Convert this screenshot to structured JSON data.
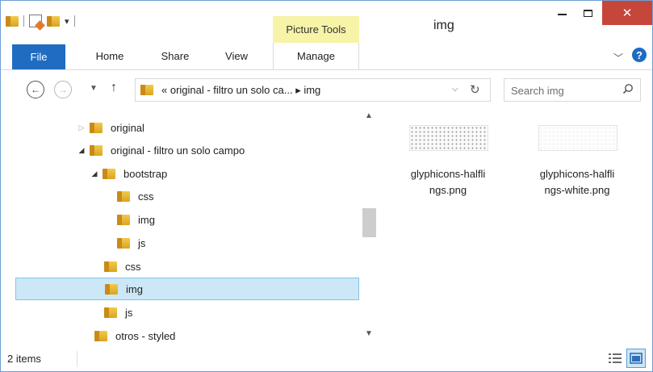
{
  "window": {
    "title": "img",
    "context_tab": "Picture Tools",
    "close_symbol": "✕"
  },
  "ribbon": {
    "tabs": [
      "File",
      "Home",
      "Share",
      "View",
      "Manage"
    ]
  },
  "address": {
    "path_text": "«  original - filtro un solo ca...  ▸  img",
    "search_placeholder": "Search img"
  },
  "tree": {
    "items": [
      {
        "label": "original",
        "expanded": false
      },
      {
        "label": "original - filtro un solo campo",
        "expanded": true
      },
      {
        "label": "bootstrap",
        "expanded": true
      },
      {
        "label": "css"
      },
      {
        "label": "img"
      },
      {
        "label": "js"
      },
      {
        "label": "css"
      },
      {
        "label": "img",
        "selected": true
      },
      {
        "label": "js"
      },
      {
        "label": "otros - styled"
      }
    ]
  },
  "files": [
    {
      "name": "glyphicons-halflings.png",
      "name_lines": [
        "glyphicons-halfli",
        "ngs.png"
      ]
    },
    {
      "name": "glyphicons-halflings-white.png",
      "name_lines": [
        "glyphicons-halfli",
        "ngs-white.png"
      ]
    }
  ],
  "status": {
    "items_count": "2 items"
  },
  "colors": {
    "accent": "#1f6cc2",
    "context_tab_bg": "#f7f3a7",
    "close_button": "#c7463a",
    "selection_bg": "#cce8f7"
  }
}
